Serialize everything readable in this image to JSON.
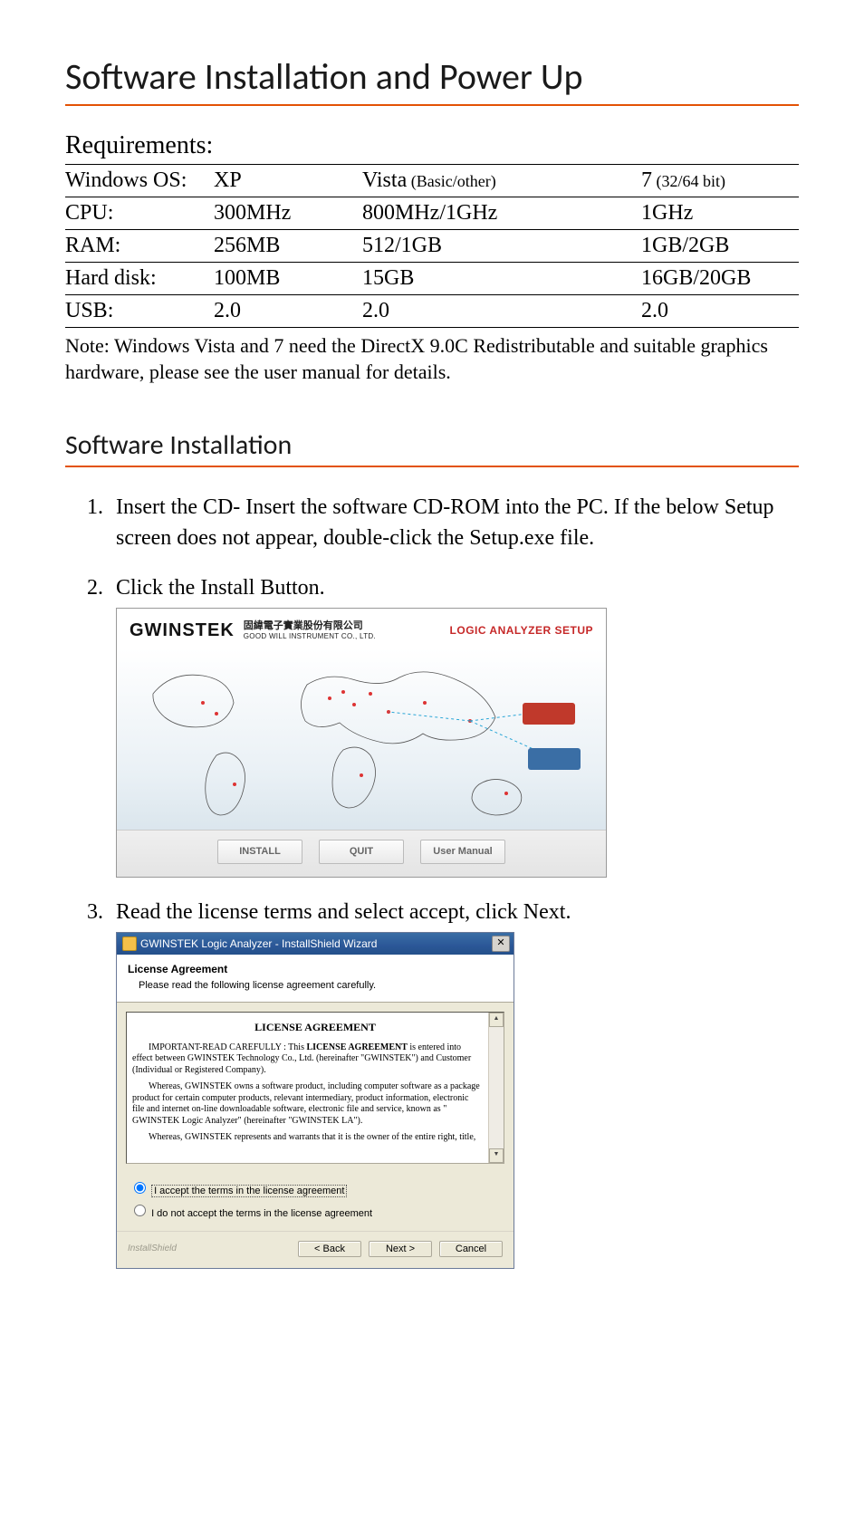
{
  "title": "Software Installation and Power Up",
  "requirements": {
    "heading": "Requirements:",
    "rows": [
      {
        "label": "Windows OS:",
        "c1": "XP",
        "c2_a": "Vista",
        "c2_b": " (Basic/other)",
        "c3_a": "7",
        "c3_b": " (32/64 bit)"
      },
      {
        "label": "CPU:",
        "c1": "300MHz",
        "c2": "800MHz/1GHz",
        "c3": "1GHz"
      },
      {
        "label": "RAM:",
        "c1": "256MB",
        "c2": "512/1GB",
        "c3": "1GB/2GB"
      },
      {
        "label": "Hard disk:",
        "c1": "100MB",
        "c2": "15GB",
        "c3": "16GB/20GB"
      },
      {
        "label": "USB:",
        "c1": "2.0",
        "c2": "2.0",
        "c3": "2.0"
      }
    ],
    "note": "Note: Windows Vista and 7 need the DirectX 9.0C Redistributable and suitable graphics hardware, please see the user manual for details."
  },
  "softwareInstallation": {
    "heading": "Software Installation",
    "steps": [
      "Insert the CD- Insert the software CD-ROM into the PC. If the below Setup screen does not appear, double-click the Setup.exe file.",
      "Click the Install Button.",
      "Read the license terms and select accept, click Next."
    ]
  },
  "setupScreenshot": {
    "brand": "GWINSTEK",
    "brandSubCn": "固緯電子實業股份有限公司",
    "brandSubEn": "GOOD WILL INSTRUMENT CO., LTD.",
    "rightTitle": "LOGIC ANALYZER SETUP",
    "buttons": {
      "install": "INSTALL",
      "quit": "QUIT",
      "manual": "User Manual"
    }
  },
  "wizard": {
    "title": "GWINSTEK Logic Analyzer - InstallShield Wizard",
    "closeGlyph": "✕",
    "headTitle": "License Agreement",
    "headSub": "Please read the following license agreement carefully.",
    "licenseTitle": "LICENSE AGREEMENT",
    "p1a": "IMPORTANT-READ CAREFULLY : This ",
    "p1b": "LICENSE AGREEMENT",
    "p1c": " is entered into effect between GWINSTEK Technology Co., Ltd. (hereinafter \"GWINSTEK\") and Customer (Individual or Registered Company).",
    "p2": "Whereas, GWINSTEK owns a software product, including computer software as a package product for certain computer products, relevant intermediary, product information, electronic file and internet on-line downloadable software, electronic file and service, known as \" GWINSTEK Logic Analyzer\" (hereinafter \"GWINSTEK LA\").",
    "p3": "Whereas, GWINSTEK represents and warrants that it is the owner of the entire right, title,",
    "radioAccept": "I accept the terms in the license agreement",
    "radioDecline": "I do not accept the terms in the license agreement",
    "installshield": "InstallShield",
    "btnBack": "< Back",
    "btnNext": "Next >",
    "btnCancel": "Cancel",
    "scrollUp": "▲",
    "scrollDown": "▼"
  }
}
